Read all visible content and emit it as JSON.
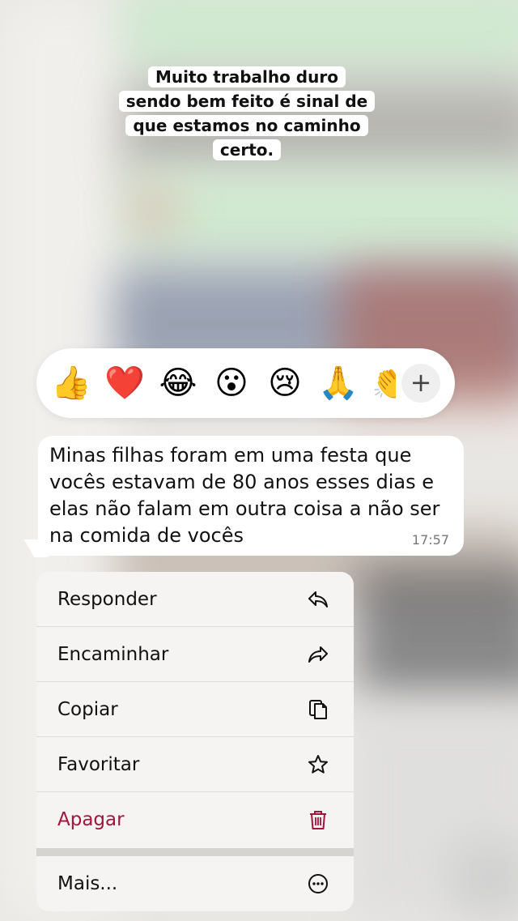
{
  "caption": {
    "lines": [
      "Muito trabalho duro",
      "sendo bem feito é sinal de",
      "que estamos no caminho",
      "certo."
    ]
  },
  "reactions": {
    "emojis": [
      "👍",
      "❤️",
      "😂",
      "😮",
      "😢",
      "🙏",
      "👏"
    ],
    "more_label": "+"
  },
  "message": {
    "text": "Minas filhas foram em uma festa que vocês estavam de 80 anos esses dias e elas não falam em outra coisa a não ser na comida de vocês",
    "time": "17:57"
  },
  "menu": {
    "items": [
      {
        "label": "Responder",
        "icon": "reply-icon"
      },
      {
        "label": "Encaminhar",
        "icon": "forward-icon"
      },
      {
        "label": "Copiar",
        "icon": "copy-icon"
      },
      {
        "label": "Favoritar",
        "icon": "star-icon"
      },
      {
        "label": "Apagar",
        "icon": "trash-icon"
      },
      {
        "label": "Mais...",
        "icon": "more-icon"
      }
    ],
    "danger_color": "#a1163a"
  }
}
